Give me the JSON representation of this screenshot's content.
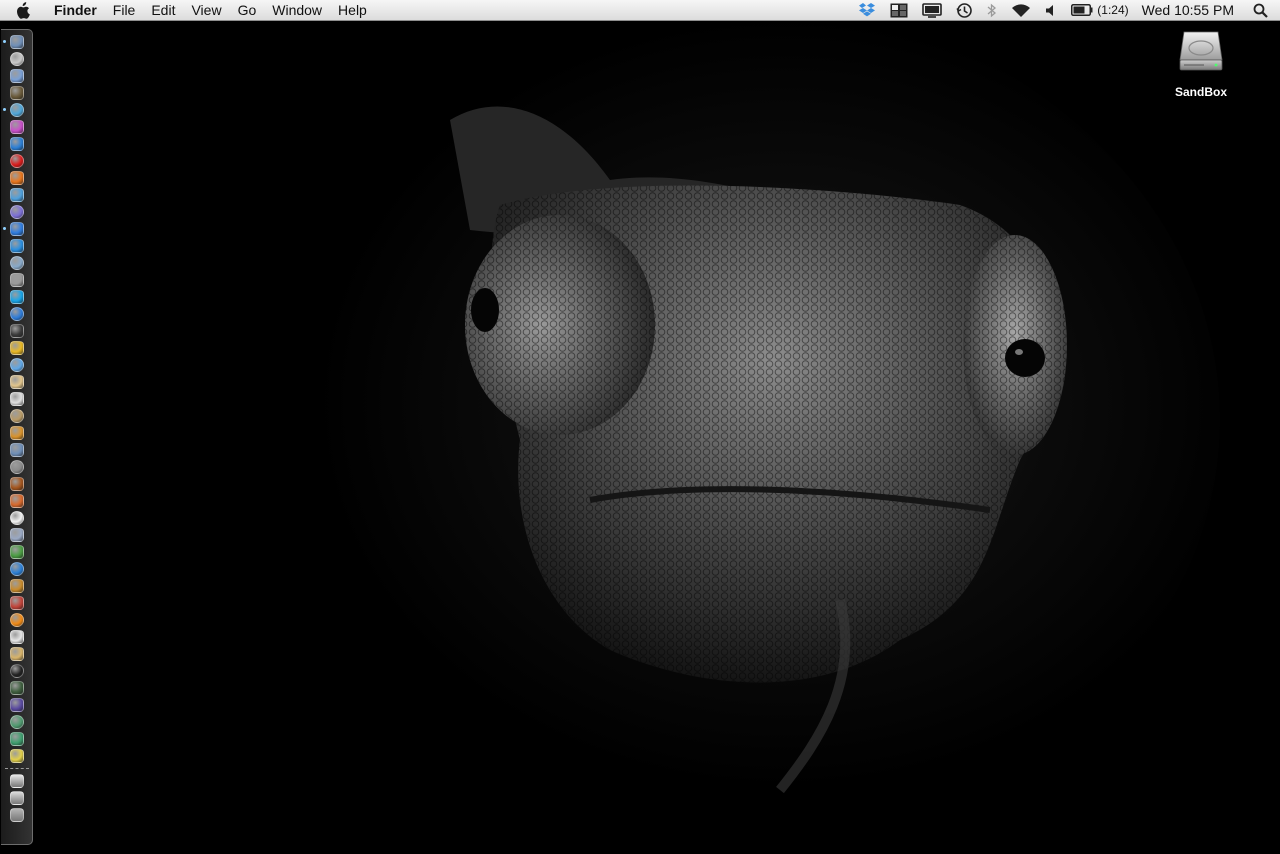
{
  "menubar": {
    "app_name": "Finder",
    "items": [
      "File",
      "Edit",
      "View",
      "Go",
      "Window",
      "Help"
    ],
    "battery_time": "(1:24)",
    "clock": "Wed 10:55 PM",
    "status_icons": [
      "dropbox-icon",
      "spaces-icon",
      "display-icon",
      "time-machine-icon",
      "bluetooth-icon",
      "wifi-icon",
      "volume-icon",
      "battery-icon",
      "spotlight-icon"
    ]
  },
  "desktop": {
    "drive_label": "SandBox",
    "wallpaper": "chameleon-wallpaper"
  },
  "dock": {
    "orientation": "left",
    "items": [
      {
        "name": "dock-app-preview",
        "color": "#6f8fb8"
      },
      {
        "name": "dock-app-safari",
        "color": "#c9c9c9"
      },
      {
        "name": "dock-app-image",
        "color": "#7aa0d6"
      },
      {
        "name": "dock-app-bottle",
        "color": "#6a5a3a"
      },
      {
        "name": "dock-app-chat",
        "color": "#4fa6d8"
      },
      {
        "name": "dock-app-itunes",
        "color": "#c94fc9"
      },
      {
        "name": "dock-app-teamviewer",
        "color": "#2b7fd6"
      },
      {
        "name": "dock-app-opera",
        "color": "#d91c1c"
      },
      {
        "name": "dock-app-firefox",
        "color": "#e8761d"
      },
      {
        "name": "dock-app-safari-2",
        "color": "#4ea0dc"
      },
      {
        "name": "dock-app-istat",
        "color": "#7c6fd6"
      },
      {
        "name": "dock-app-compass",
        "color": "#2f7de0"
      },
      {
        "name": "dock-app-itunes-2",
        "color": "#2a8fe0"
      },
      {
        "name": "dock-app-preview-2",
        "color": "#88a9c9"
      },
      {
        "name": "dock-app-monitor",
        "color": "#9a9a9a"
      },
      {
        "name": "dock-app-skype",
        "color": "#18a5e8"
      },
      {
        "name": "dock-app-dropbox",
        "color": "#2d7bd8"
      },
      {
        "name": "dock-app-sphere",
        "color": "#3a3a3a"
      },
      {
        "name": "dock-app-chrome",
        "color": "#e9b824"
      },
      {
        "name": "dock-app-ichat",
        "color": "#5fa7e6"
      },
      {
        "name": "dock-app-notes",
        "color": "#e2c58c"
      },
      {
        "name": "dock-app-calendar",
        "color": "#e0e0e0"
      },
      {
        "name": "dock-app-address-book",
        "color": "#b89a66"
      },
      {
        "name": "dock-app-iphoto",
        "color": "#d9922b"
      },
      {
        "name": "dock-app-grid",
        "color": "#6f8fb8"
      },
      {
        "name": "dock-app-screenshot",
        "color": "#8a8a8a"
      },
      {
        "name": "dock-app-football",
        "color": "#a5561e"
      },
      {
        "name": "dock-app-stamp",
        "color": "#d8692c"
      },
      {
        "name": "dock-app-textedit",
        "color": "#f2f2f2"
      },
      {
        "name": "dock-app-pen",
        "color": "#9aa9c4"
      },
      {
        "name": "dock-app-palette",
        "color": "#4b9d43"
      },
      {
        "name": "dock-app-ie",
        "color": "#2b7fd6"
      },
      {
        "name": "dock-app-guitar",
        "color": "#c98b2b"
      },
      {
        "name": "dock-app-fruit",
        "color": "#c2443a"
      },
      {
        "name": "dock-app-vlc",
        "color": "#f08a16"
      },
      {
        "name": "dock-app-player",
        "color": "#e6e6e6"
      },
      {
        "name": "dock-app-script",
        "color": "#d8b46a"
      },
      {
        "name": "dock-app-terminal",
        "color": "#222222"
      },
      {
        "name": "dock-app-activity",
        "color": "#3f5f3f"
      },
      {
        "name": "dock-app-quicksilver",
        "color": "#5a4aa0"
      },
      {
        "name": "dock-app-photos",
        "color": "#4f9a6f"
      },
      {
        "name": "dock-app-globe",
        "color": "#3f9f6f"
      },
      {
        "name": "dock-app-star",
        "color": "#e2d04a"
      }
    ],
    "running_indicators": [
      0,
      4,
      11
    ],
    "trailing_items": [
      {
        "name": "dock-documents-stack",
        "color": "#e8e8e8"
      },
      {
        "name": "dock-downloads-stack",
        "color": "#dcdcdc"
      },
      {
        "name": "dock-trash",
        "color": "#b5b5b5"
      }
    ]
  }
}
